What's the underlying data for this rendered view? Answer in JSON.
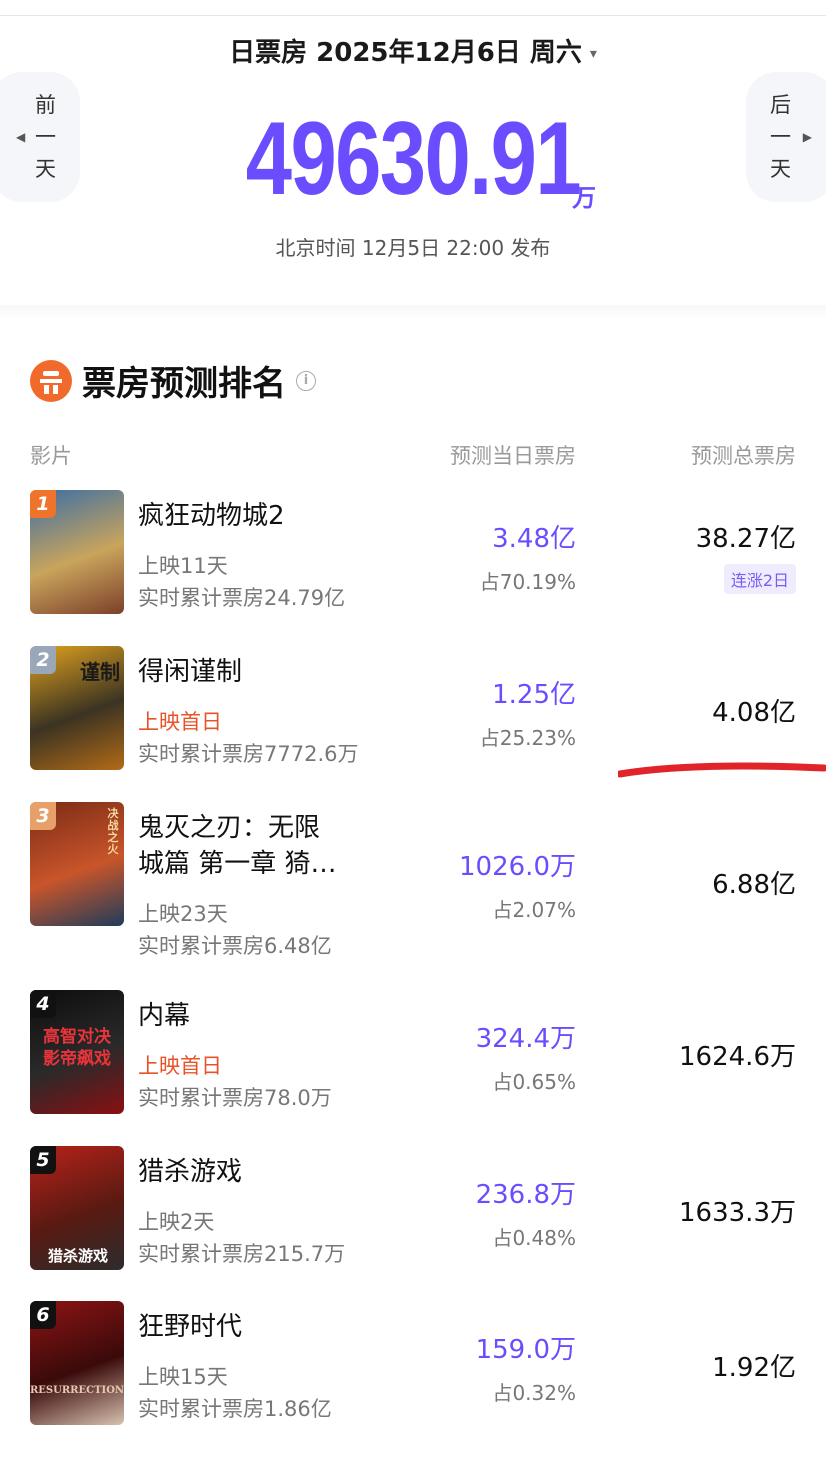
{
  "header": {
    "date_title": "日票房 2025年12月6日 周六",
    "dropdown_caret": "▾",
    "prev_day": [
      "前",
      "一",
      "天"
    ],
    "next_day": [
      "后",
      "一",
      "天"
    ],
    "prev_arrow": "◀",
    "next_arrow": "▶",
    "total_value": "49630.91",
    "total_unit": "万",
    "publish_time": "北京时间 12月5日 22:00 发布"
  },
  "section": {
    "title": "票房预测排名",
    "info_glyph": "i",
    "columns": {
      "film": "影片",
      "day": "预测当日票房",
      "total": "预测总票房"
    }
  },
  "movies": [
    {
      "rank": "1",
      "title": "疯狂动物城2",
      "title2": "",
      "release": "上映11天",
      "release_first_day": false,
      "cumulative": "实时累计票房24.79亿",
      "day_box": "3.48亿",
      "share": "占70.19%",
      "total_box": "38.27亿",
      "badge": "连涨2日",
      "rank_color": "#f0732c",
      "poster_colors": [
        "#3a6ea5",
        "#c9a45c",
        "#7c3f2a"
      ]
    },
    {
      "rank": "2",
      "title": "得闲谨制",
      "title2": "",
      "release": "上映首日",
      "release_first_day": true,
      "cumulative": "实时累计票房7772.6万",
      "day_box": "1.25亿",
      "share": "占25.23%",
      "total_box": "4.08亿",
      "badge": "",
      "rank_color": "#9aa7b8",
      "poster_colors": [
        "#e0a21e",
        "#3b3322",
        "#b26b17"
      ]
    },
    {
      "rank": "3",
      "title": "鬼灭之刃：无限",
      "title2": "城篇 第一章 猗…",
      "release": "上映23天",
      "release_first_day": false,
      "cumulative": "实时累计票房6.48亿",
      "day_box": "1026.0万",
      "share": "占2.07%",
      "total_box": "6.88亿",
      "badge": "",
      "rank_color": "#e8a06a",
      "poster_colors": [
        "#7a2a16",
        "#c8552a",
        "#1f3c5a"
      ]
    },
    {
      "rank": "4",
      "title": "内幕",
      "title2": "",
      "release": "上映首日",
      "release_first_day": true,
      "cumulative": "实时累计票房78.0万",
      "day_box": "324.4万",
      "share": "占0.65%",
      "total_box": "1624.6万",
      "badge": "",
      "rank_color": "#111111",
      "poster_colors": [
        "#0d0d0d",
        "#2a2a2a",
        "#8a0f12"
      ]
    },
    {
      "rank": "5",
      "title": "猎杀游戏",
      "title2": "",
      "release": "上映2天",
      "release_first_day": false,
      "cumulative": "实时累计票房215.7万",
      "day_box": "236.8万",
      "share": "占0.48%",
      "total_box": "1633.3万",
      "badge": "",
      "rank_color": "#111111",
      "poster_colors": [
        "#b8221a",
        "#5a1a12",
        "#2c2c2c"
      ]
    },
    {
      "rank": "6",
      "title": "狂野时代",
      "title2": "",
      "release": "上映15天",
      "release_first_day": false,
      "cumulative": "实时累计票房1.86亿",
      "day_box": "159.0万",
      "share": "占0.32%",
      "total_box": "1.92亿",
      "badge": "",
      "rank_color": "#111111",
      "poster_colors": [
        "#8e1414",
        "#3a0a0a",
        "#d8c2b0"
      ]
    }
  ],
  "poster_text": {
    "p2": "谨制",
    "p3": "决战之火",
    "p4": "高智对决 影帝飙戏",
    "p5": "猎杀游戏",
    "p6": "RESURRECTION"
  },
  "colors": {
    "accent": "#6b4dff",
    "first_day": "#e8542a",
    "badge_bg": "#f0ecff",
    "annotation_red": "#e0242a"
  }
}
